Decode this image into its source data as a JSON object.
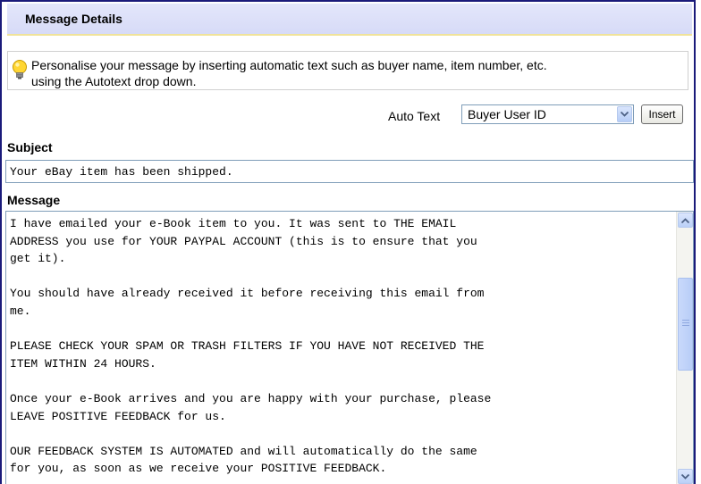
{
  "header": {
    "title": "Message Details"
  },
  "tip": {
    "icon": "lightbulb-icon",
    "line1": "Personalise your message by inserting automatic text such as buyer name, item number, etc.",
    "line2": "using the Autotext drop down."
  },
  "autotext": {
    "label": "Auto Text",
    "selected": "Buyer User ID",
    "insert_label": "Insert"
  },
  "subject": {
    "label": "Subject",
    "value": "Your eBay item has been shipped."
  },
  "message": {
    "label": "Message",
    "body": "I have emailed your e-Book item to you. It was sent to THE EMAIL\nADDRESS you use for YOUR PAYPAL ACCOUNT (this is to ensure that you\nget it).\n\nYou should have already received it before receiving this email from\nme.\n\nPLEASE CHECK YOUR SPAM OR TRASH FILTERS IF YOU HAVE NOT RECEIVED THE\nITEM WITHIN 24 HOURS.\n\nOnce your e-Book arrives and you are happy with your purchase, please\nLEAVE POSITIVE FEEDBACK for us.\n\nOUR FEEDBACK SYSTEM IS AUTOMATED and will automatically do the same\nfor you, as soon as we receive your POSITIVE FEEDBACK."
  },
  "colors": {
    "header_bg": "#dde1f9",
    "frame_border": "#1a1a7a",
    "input_border": "#7f9db9"
  }
}
